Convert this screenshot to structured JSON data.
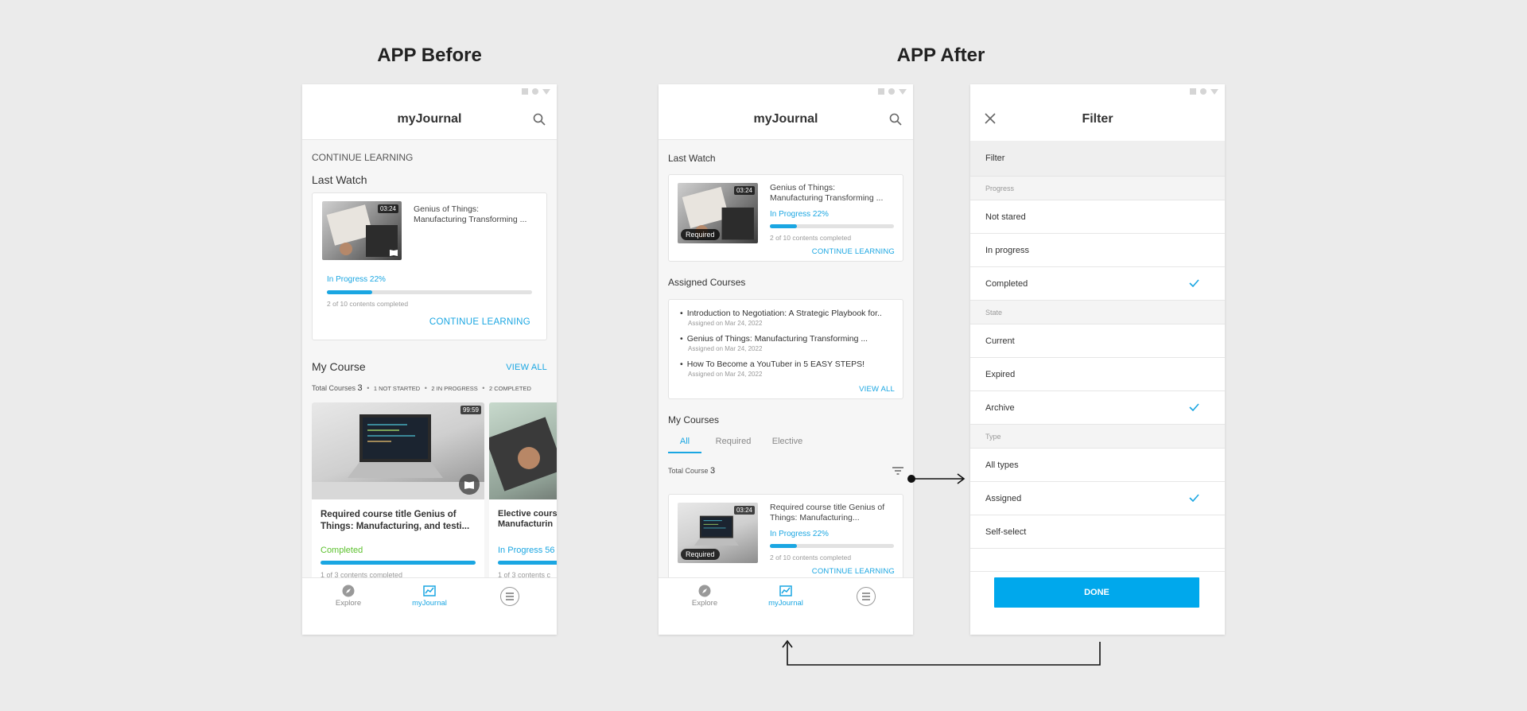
{
  "headings": {
    "before": "APP Before",
    "after": "APP After"
  },
  "app_title": "myJournal",
  "before": {
    "continue_learning_header": "CONTINUE LEARNING",
    "last_watch": "Last Watch",
    "lw_duration": "03:24",
    "lw_title_line1": "Genius of Things:",
    "lw_title_line2": "Manufacturing Transforming ...",
    "lw_progress": "In Progress 22%",
    "lw_progress_value": 0.22,
    "lw_completed": "2 of 10 contents completed",
    "lw_link": "CONTINUE LEARNING",
    "my_course": "My Course",
    "view_all": "VIEW ALL",
    "total_label": "Total Courses",
    "total_count": "3",
    "stat_not_started": "1 NOT STARTED",
    "stat_in_progress": "2 IN PROGRESS",
    "stat_completed": "2 COMPLETED",
    "course1": {
      "duration": "99:59",
      "title_line1": "Required course title Genius of",
      "title_line2": "Things: Manufacturing, and testi...",
      "status": "Completed",
      "progress_value": 1.0,
      "contents": "1 of 3 contents completed"
    },
    "course2": {
      "title_line1": "Elective cours",
      "title_line2": "Manufacturin",
      "status": "In Progress 56",
      "contents": "1 of 3 contents c"
    }
  },
  "after": {
    "last_watch": "Last Watch",
    "lw_duration": "03:24",
    "lw_badge": "Required",
    "lw_title_line1": "Genius of Things:",
    "lw_title_line2": "Manufacturing Transforming ...",
    "lw_progress": "In Progress 22%",
    "lw_progress_value": 0.22,
    "lw_completed": "2 of 10 contents completed",
    "lw_link": "CONTINUE LEARNING",
    "assigned_courses": "Assigned Courses",
    "assigned": [
      {
        "title": "Introduction to Negotiation: A Strategic Playbook for..",
        "date": "Assigned on Mar 24, 2022"
      },
      {
        "title": "Genius of Things: Manufacturing Transforming ...",
        "date": "Assigned on Mar 24, 2022"
      },
      {
        "title": "How To Become a YouTuber in 5 EASY STEPS!",
        "date": "Assigned on Mar 24, 2022"
      }
    ],
    "view_all": "VIEW ALL",
    "my_courses": "My Courses",
    "tabs": [
      "All",
      "Required",
      "Elective"
    ],
    "total_label": "Total Course",
    "total_count": "3",
    "course1": {
      "duration": "03:24",
      "badge": "Required",
      "title_line1": "Required course title Genius of",
      "title_line2": "Things: Manufacturing...",
      "progress": "In Progress 22%",
      "progress_value": 0.22,
      "completed": "2 of 10 contents completed",
      "link": "CONTINUE LEARNING"
    }
  },
  "nav": {
    "explore": "Explore",
    "journal": "myJournal"
  },
  "filter": {
    "title": "Filter",
    "header": "Filter",
    "progress_label": "Progress",
    "progress_options": [
      "Not stared",
      "In progress",
      "Completed"
    ],
    "state_label": "State",
    "state_options": [
      "Current",
      "Expired",
      "Archive"
    ],
    "type_label": "Type",
    "type_options": [
      "All types",
      "Assigned",
      "Self-select"
    ],
    "done": "DONE"
  },
  "colors": {
    "accent": "#1aa6e2",
    "done_button": "#00a8ec",
    "completed": "#5cc12e"
  }
}
